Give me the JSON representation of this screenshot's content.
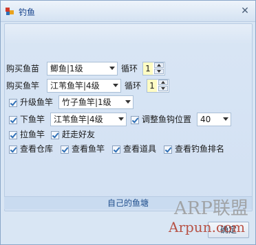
{
  "window": {
    "title": "钓鱼",
    "close_symbol": "✕"
  },
  "buy_bait": {
    "label": "购买鱼苗",
    "combo_value": "鲫鱼|1级",
    "loop_label": "循环",
    "loop_value": "1"
  },
  "buy_rod": {
    "label": "购买鱼竿",
    "combo_value": "江苇鱼竿|4级",
    "loop_label": "循环",
    "loop_value": "1"
  },
  "upgrade_rod": {
    "label": "升级鱼竿",
    "checked": true,
    "combo_value": "竹子鱼竿|1级"
  },
  "lower_rod": {
    "label": "下鱼竿",
    "checked": true,
    "combo_value": "江苇鱼竿|4级"
  },
  "adjust_hook": {
    "label": "调整鱼钩位置",
    "checked": true,
    "combo_value": "40"
  },
  "pull_rod": {
    "label": "拉鱼竿",
    "checked": true
  },
  "drive_friends": {
    "label": "赶走好友",
    "checked": true
  },
  "view": {
    "warehouse": "查看仓库",
    "rods": "查看鱼竿",
    "items": "查看道具",
    "ranking": "查看钓鱼排名"
  },
  "group_caption": "自己的鱼塘",
  "confirm_label": "确定",
  "watermark": {
    "line1": "ARP联盟",
    "line2": "Arpun.com"
  },
  "icons": {
    "app": "fishing-app-icon",
    "close": "close-icon",
    "checkbox_check": "check-icon"
  },
  "colors": {
    "accent": "#15428b",
    "spin_bg": "#fffcc4",
    "window_bg": "#d9e6f4"
  }
}
